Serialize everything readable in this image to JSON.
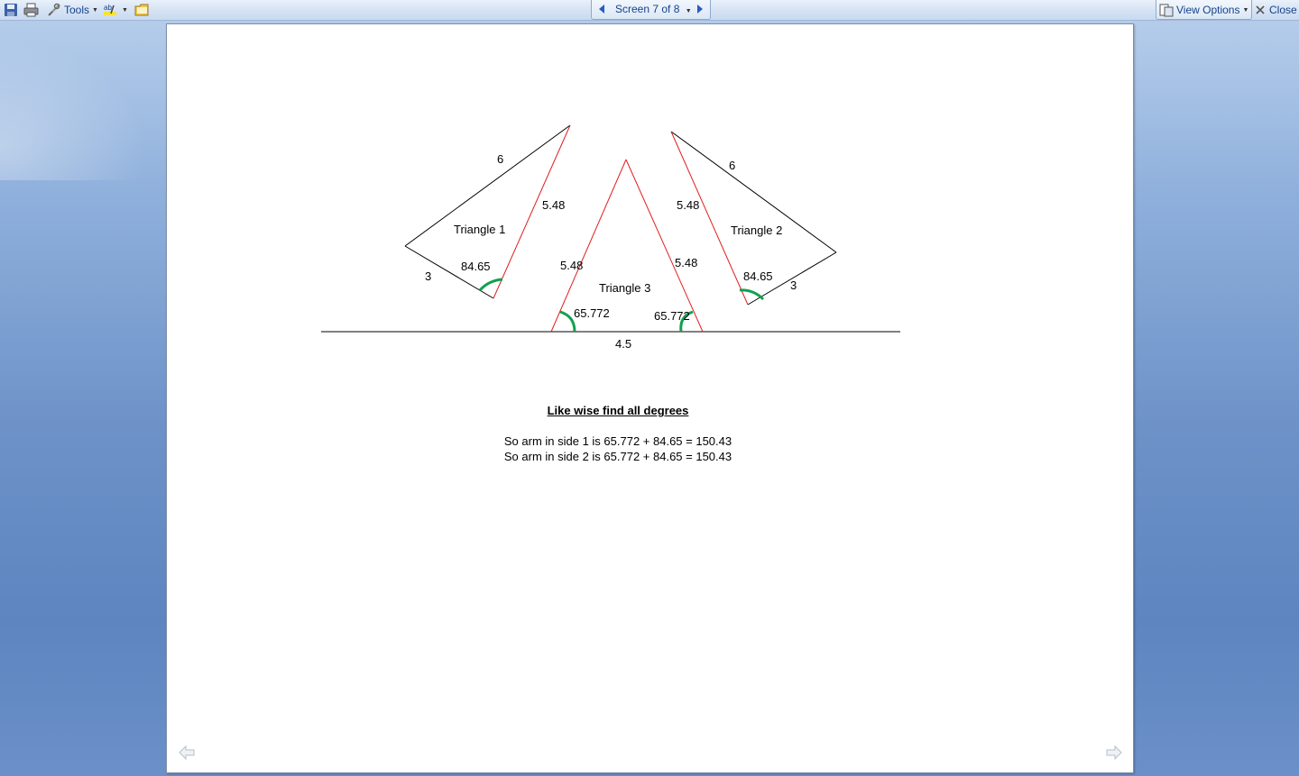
{
  "toolbar": {
    "tools_label": "Tools",
    "screen_label": "Screen 7 of 8",
    "view_options_label": "View Options",
    "close_label": "Close",
    "icons": [
      "save-icon",
      "print-icon",
      "tools-icon",
      "spelling-icon",
      "folder-icon"
    ]
  },
  "diagram": {
    "triangle1": {
      "name": "Triangle 1",
      "side_top": "6",
      "side_right": "5.48",
      "side_left": "3",
      "angle": "84.65"
    },
    "triangle2": {
      "name": "Triangle 2",
      "side_top": "6",
      "side_left": "5.48",
      "side_right": "3",
      "angle": "84.65"
    },
    "triangle3": {
      "name": "Triangle 3",
      "side_left": "5.48",
      "side_right": "5.48",
      "base": "4.5",
      "angle_left": "65.772",
      "angle_right": "65.772"
    },
    "colors": {
      "red_edge": "#e21d1d",
      "angle_arc": "#12a050",
      "black_edge": "#000000"
    }
  },
  "text": {
    "heading": "Like wise find all degrees",
    "line1": "So arm in side 1 is 65.772 + 84.65 = 150.43",
    "line2": "So arm in side 2 is 65.772 + 84.65 = 150.43"
  }
}
